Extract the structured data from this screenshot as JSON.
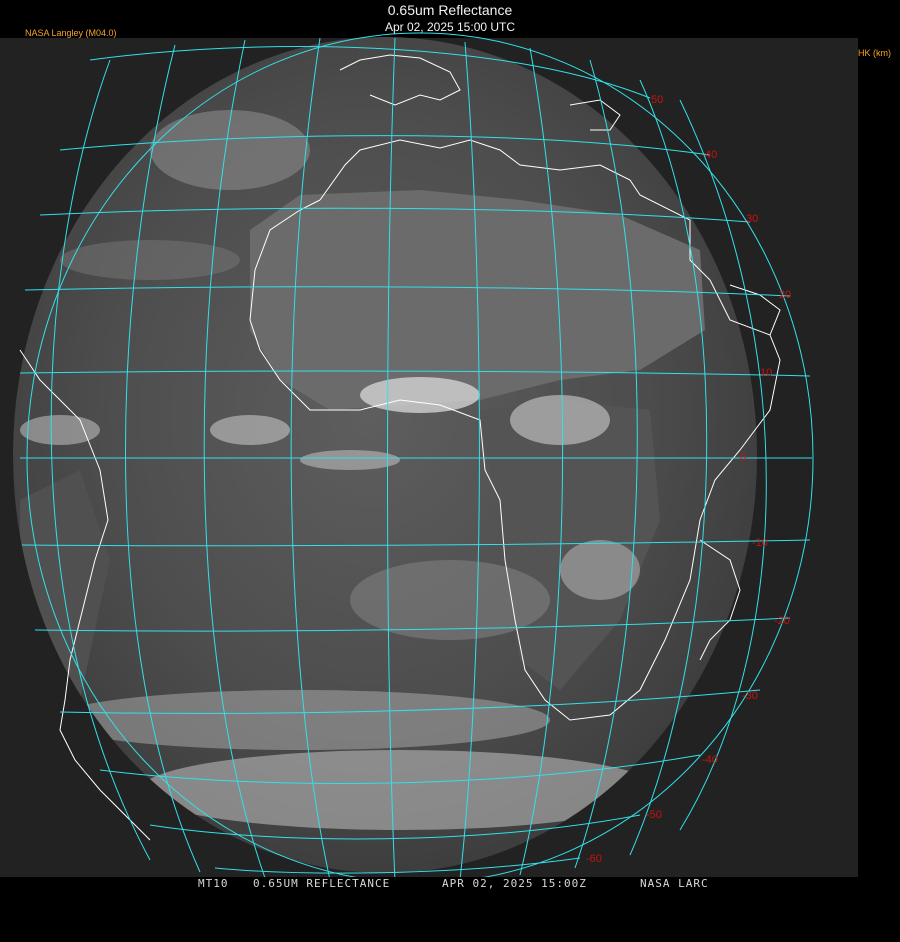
{
  "header": {
    "title": "0.65um Reflectance",
    "subtitle": "Apr 02, 2025 15:00 UTC",
    "left_credit": "NASA Langley (M04.0)",
    "right_legend": "ZTHK (km)"
  },
  "footer": {
    "items": [
      "MT10",
      "0.65UM REFLECTANCE",
      "APR 02, 2025 15:00Z",
      "NASA LARC"
    ]
  },
  "grid": {
    "latitude_labels": [
      "50",
      "40",
      "30",
      "20",
      "10",
      "0",
      "-10",
      "-20",
      "-30",
      "-40",
      "-50",
      "-60"
    ],
    "grid_color": "#33e0e8",
    "label_color": "#cc1111",
    "coast_color": "#ffffff"
  }
}
